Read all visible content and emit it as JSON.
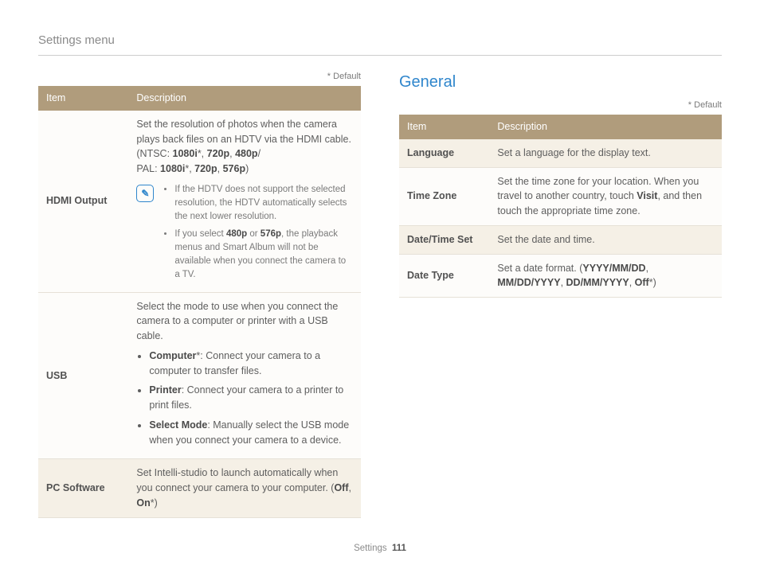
{
  "header": {
    "title": "Settings menu"
  },
  "footer": {
    "section": "Settings",
    "page": "111"
  },
  "default_note": "* Default",
  "table_headers": {
    "item": "Item",
    "desc": "Description"
  },
  "left": {
    "rows": [
      {
        "item": "HDMI Output",
        "desc_intro": "Set the resolution of photos when the camera plays back files on an HDTV via the HDMI cable.",
        "ntsc_label": "(NTSC: ",
        "ntsc_values": [
          "1080i",
          "720p",
          "480p"
        ],
        "pal_label": " PAL: ",
        "pal_values": [
          "1080i",
          "720p",
          "576p"
        ],
        "note1_a": "If the HDTV does not support the selected resolution, the HDTV automatically selects the next lower resolution.",
        "note2_a": "If you select ",
        "note2_b": "480p",
        "note2_c": " or ",
        "note2_d": "576p",
        "note2_e": ", the playback menus and Smart Album will not be available when you connect the camera to a TV."
      },
      {
        "item": "USB",
        "desc_intro": "Select the mode to use when you connect the camera to a computer or printer with a USB cable.",
        "opt1_name": "Computer",
        "opt1_star": "*",
        "opt1_desc": ": Connect your camera to a computer to transfer files.",
        "opt2_name": "Printer",
        "opt2_desc": ": Connect your camera to a printer to print files.",
        "opt3_name": "Select Mode",
        "opt3_desc": ": Manually select the USB mode when you connect your camera to a device."
      },
      {
        "item": "PC Software",
        "desc_a": "Set Intelli-studio to launch automatically when you connect your camera to your computer. (",
        "desc_b": "Off",
        "desc_c": ", ",
        "desc_d": "On",
        "desc_e": "*",
        "desc_f": ")"
      }
    ]
  },
  "right": {
    "title": "General",
    "rows": [
      {
        "item": "Language",
        "desc": "Set a language for the display text."
      },
      {
        "item": "Time Zone",
        "desc_a": "Set the time zone for your location. When you travel to another country, touch ",
        "desc_b": "Visit",
        "desc_c": ", and then touch the appropriate time zone."
      },
      {
        "item": "Date/Time Set",
        "desc": "Set the date and time."
      },
      {
        "item": "Date Type",
        "desc_a": "Set a date format. (",
        "v1": "YYYY/MM/DD",
        "s1": ", ",
        "v2": "MM/DD/YYYY",
        "s2": ", ",
        "v3": "DD/MM/YYYY",
        "s3": ", ",
        "v4": "Off",
        "star": "*",
        "close": ")"
      }
    ]
  }
}
